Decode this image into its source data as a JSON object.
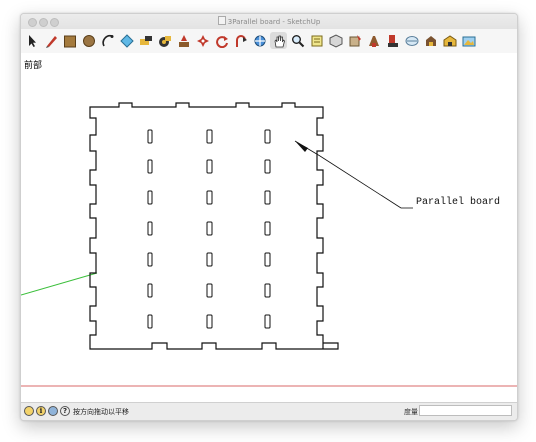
{
  "window": {
    "title": "3Parallel board - SketchUp"
  },
  "toolbar": {
    "tools": [
      {
        "name": "select-tool",
        "icon": "arrow-icon"
      },
      {
        "name": "eraser-tool",
        "icon": "eraser-icon"
      },
      {
        "name": "paint-bucket-tool",
        "icon": "bucket-icon"
      },
      {
        "name": "rectangle-tool",
        "icon": "rectangle-icon"
      },
      {
        "name": "circle-tool",
        "icon": "circle-icon"
      },
      {
        "name": "arc-tool",
        "icon": "arc-icon"
      },
      {
        "name": "push-pull-tool",
        "icon": "push-pull-icon"
      },
      {
        "name": "tape-measure-tool",
        "icon": "tape-measure-icon"
      },
      {
        "name": "paint-tool",
        "icon": "paint-icon"
      },
      {
        "name": "move-tool",
        "icon": "move-icon"
      },
      {
        "name": "rotate-tool",
        "icon": "rotate-icon"
      },
      {
        "name": "follow-me-tool",
        "icon": "follow-me-icon"
      },
      {
        "name": "orbit-tool",
        "icon": "orbit-icon"
      },
      {
        "name": "pan-tool",
        "icon": "hand-icon"
      },
      {
        "name": "zoom-tool",
        "icon": "magnifier-icon"
      },
      {
        "name": "warehouse-tool",
        "icon": "warehouse-icon"
      },
      {
        "name": "components-tool",
        "icon": "components-icon"
      },
      {
        "name": "extension-tool",
        "icon": "extension-icon"
      },
      {
        "name": "styles-tool",
        "icon": "styles-icon"
      },
      {
        "name": "sandbox-tool",
        "icon": "sandbox-icon"
      },
      {
        "name": "layout-tool",
        "icon": "layout-icon"
      },
      {
        "name": "shadows-tool",
        "icon": "shadows-icon"
      }
    ]
  },
  "viewport": {
    "scene_name": "前部",
    "annotation": "Parallel board"
  },
  "statusbar": {
    "hint": "按方向拖动以平移",
    "measurements_label": "度量",
    "measurements_value": ""
  },
  "colors": {
    "green_axis": "#3bbf3b",
    "red_axis": "#d96a6a",
    "model_line": "#111111"
  }
}
